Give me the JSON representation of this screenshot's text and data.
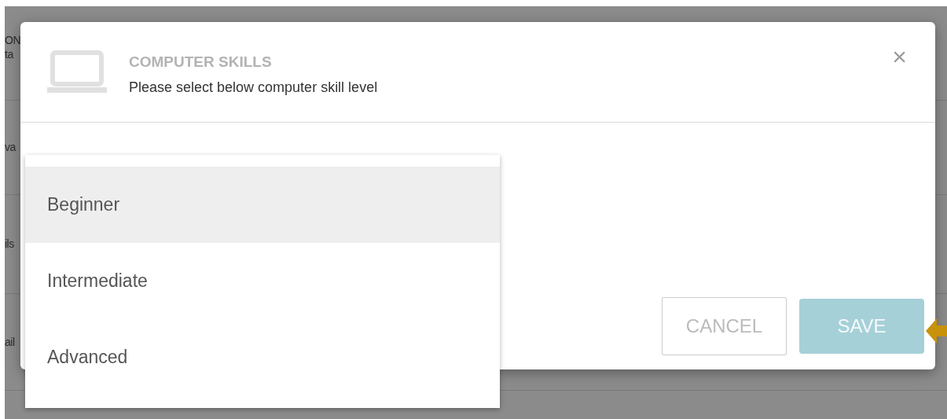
{
  "background_page": {
    "fragments": [
      {
        "text": "ON"
      },
      {
        "text": "ta"
      },
      {
        "text": "va"
      },
      {
        "text": "ils"
      },
      {
        "text": "ail"
      }
    ]
  },
  "dialog": {
    "title": "COMPUTER SKILLS",
    "subtitle": "Please select below computer skill level",
    "close": "×",
    "buttons": [
      {
        "label": "CANCEL",
        "kind": "secondary"
      },
      {
        "label": "SAVE",
        "kind": "primary",
        "disabled": true
      }
    ]
  },
  "dropdown": {
    "options": [
      {
        "label": "Beginner",
        "selected": true
      },
      {
        "label": "Intermediate",
        "selected": false
      },
      {
        "label": "Advanced",
        "selected": false
      }
    ]
  }
}
